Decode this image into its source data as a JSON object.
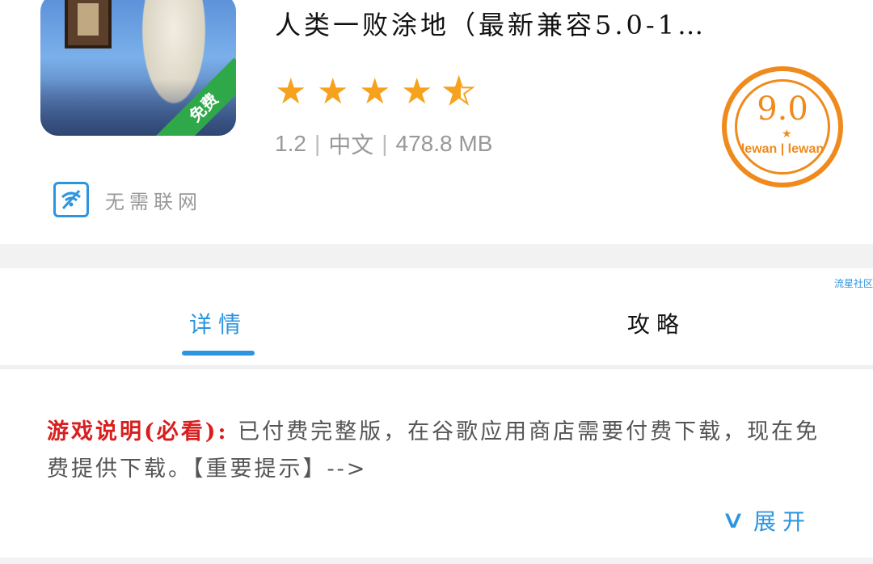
{
  "app": {
    "title": "人类一败涂地（最新兼容5.0-1…",
    "rating_stars": 4.5,
    "version": "1.2",
    "language": "中文",
    "size": "478.8 MB",
    "free_badge": "免费",
    "offline_label": "无需联网",
    "wifi_icon": "no-wifi-icon"
  },
  "score_stamp": {
    "score": "9.0",
    "brand": "lewan | lewan"
  },
  "source_tag": "流星社区",
  "tabs": [
    {
      "label": "详情",
      "active": true
    },
    {
      "label": "攻略",
      "active": false
    }
  ],
  "description": {
    "lead": "游戏说明(必看):",
    "body": " 已付费完整版，在谷歌应用商店需要付费下载，现在免费提供下载。【重要提示】-->"
  },
  "expand_label": "展开",
  "colors": {
    "accent": "#2b95e0",
    "star": "#f6a21e",
    "stamp": "#f08a1c",
    "lead_red": "#d81e1e"
  }
}
